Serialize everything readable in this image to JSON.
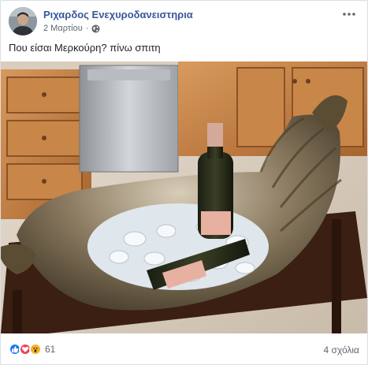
{
  "post": {
    "author": "Ριχαρδος Ενεχυροδανειστηρια",
    "date": "2 Μαρτίου",
    "separator": "·",
    "privacy_icon": "globe-icon",
    "menu_icon": "more-options-icon",
    "text": "Που είσαι Μερκούρη? πίνω σπιτη",
    "photo_subject": "silver-ice-bucket-with-champagne-bottles"
  },
  "footer": {
    "reaction_icons": [
      "like-icon",
      "love-icon",
      "wow-icon"
    ],
    "reaction_count": "61",
    "comments": "4 σχόλια"
  },
  "colors": {
    "author_link": "#385898",
    "like_blue": "#1877f2",
    "love_red": "#f33e58",
    "wow_yellow": "#f7b125",
    "muted_text": "#606770"
  }
}
